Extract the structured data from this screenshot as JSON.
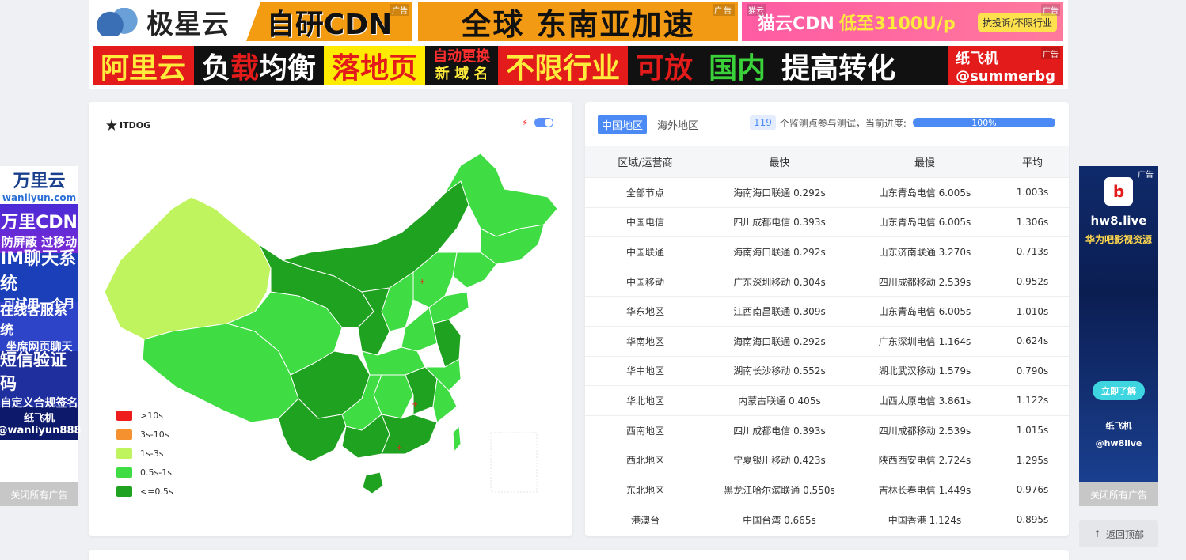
{
  "top_ads": {
    "ad_tag": "广告",
    "b1_brand": "极星云",
    "b1_tail": "自研CDN",
    "b2_text": "全球 东南亚加速",
    "b3_tag": "猫云",
    "b3_name": "猫云CDN",
    "b3_price": "低至3100U/p",
    "b3_pill": "抗投诉/不限行业",
    "b4_brand": "阿里云",
    "b4_a": "负",
    "b4_b": "载",
    "b4_c": "均衡",
    "b4_landing": "落地页",
    "b4_auto1": "自动更换",
    "b4_auto2": "新 域 名",
    "b4_unlimited": "不限行业",
    "b4_ok": "可放",
    "b4_domestic": "国内",
    "b4_boost": "提高转化",
    "b4_tg": "纸飞机",
    "b4_handle": "@summerbg"
  },
  "left_ad": {
    "logo": "万里云",
    "site": "wanliyun.com",
    "cdn": "万里CDN",
    "cdn_sub": "防屏蔽 过移动",
    "im": "IM聊天系统",
    "im_sub": "可试用一个月",
    "kf": "在线客服系统",
    "kf_sub": "坐席网页聊天",
    "sms": "短信验证码",
    "sms_sub": "自定义合规签名",
    "tg": "纸飞机",
    "handle": "@wanliyun888",
    "close": "关闭所有广告"
  },
  "right_ad": {
    "tag": "广告",
    "logo": "b",
    "site": "hw8.live",
    "desc": "华为吧影视资源",
    "button": "立即了解",
    "tg": "纸飞机",
    "handle": "@hw8live",
    "close": "关闭所有广告"
  },
  "map_card": {
    "brand": "ITDOG",
    "bolt_icon": "⚡",
    "legend": [
      {
        "label": ">10s",
        "color": "#ee1c1c"
      },
      {
        "label": "3s-10s",
        "color": "#f5922f"
      },
      {
        "label": "1s-3s",
        "color": "#bff45e"
      },
      {
        "label": "0.5s-1s",
        "color": "#3fdc43"
      },
      {
        "label": "<=0.5s",
        "color": "#1fa21f"
      }
    ]
  },
  "table_card": {
    "tab_china": "中国地区",
    "tab_overseas": "海外地区",
    "monitor_count": "119",
    "monitor_text": "个监测点参与测试，当前进度:",
    "progress": "100%",
    "headers": [
      "区域/运营商",
      "最快",
      "最慢",
      "平均"
    ],
    "rows": [
      [
        "全部节点",
        "海南海口联通 0.292s",
        "山东青岛电信 6.005s",
        "1.003s"
      ],
      [
        "中国电信",
        "四川成都电信 0.393s",
        "山东青岛电信 6.005s",
        "1.306s"
      ],
      [
        "中国联通",
        "海南海口联通 0.292s",
        "山东济南联通 3.270s",
        "0.713s"
      ],
      [
        "中国移动",
        "广东深圳移动 0.304s",
        "四川成都移动 2.539s",
        "0.952s"
      ],
      [
        "华东地区",
        "江西南昌联通 0.309s",
        "山东青岛电信 6.005s",
        "1.010s"
      ],
      [
        "华南地区",
        "海南海口联通 0.292s",
        "广东深圳电信 1.164s",
        "0.624s"
      ],
      [
        "华中地区",
        "湖南长沙移动 0.552s",
        "湖北武汉移动 1.579s",
        "0.790s"
      ],
      [
        "华北地区",
        "内蒙古联通 0.405s",
        "山西太原电信 3.861s",
        "1.122s"
      ],
      [
        "西南地区",
        "四川成都电信 0.393s",
        "四川成都移动 2.539s",
        "1.015s"
      ],
      [
        "西北地区",
        "宁夏银川移动 0.423s",
        "陕西西安电信 2.724s",
        "1.295s"
      ],
      [
        "东北地区",
        "黑龙江哈尔滨联通 0.550s",
        "吉林长春电信 1.449s",
        "0.976s"
      ],
      [
        "港澳台",
        "中国台湾 0.665s",
        "中国香港 1.124s",
        "0.895s"
      ]
    ]
  },
  "back_top": "返回顶部",
  "back_top_icon": "↑"
}
